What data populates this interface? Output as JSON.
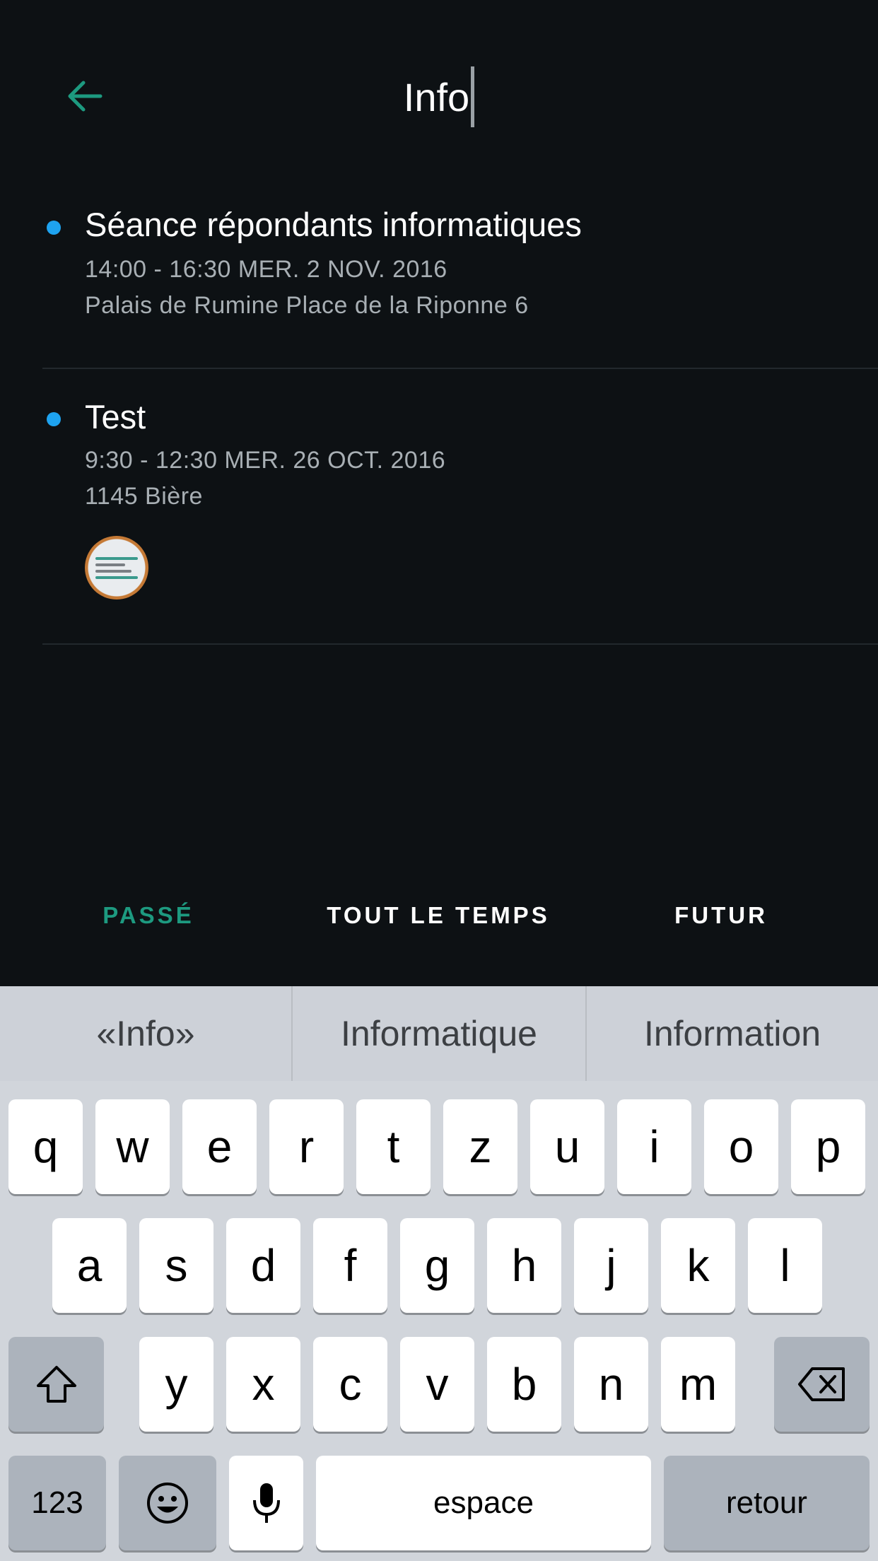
{
  "header": {
    "back_icon": "arrow-left-icon",
    "search_value": "Info",
    "accent_color": "#1d9a80"
  },
  "results": [
    {
      "title": "Séance répondants informatiques",
      "datetime": "14:00 - 16:30 MER. 2 NOV. 2016",
      "location": "Palais de Rumine Place de la Riponne 6"
    },
    {
      "title": "Test",
      "datetime": "9:30 - 12:30 MER. 26 OCT. 2016",
      "location": "1145 Bière",
      "attachment_icon": "attachment-thumbnail"
    }
  ],
  "filters": {
    "past": "PASSÉ",
    "all_time": "TOUT LE TEMPS",
    "future": "FUTUR",
    "selected": "past"
  },
  "keyboard": {
    "suggestions": [
      "«Info»",
      "Informatique",
      "Information"
    ],
    "row1": [
      "q",
      "w",
      "e",
      "r",
      "t",
      "z",
      "u",
      "i",
      "o",
      "p"
    ],
    "row2": [
      "a",
      "s",
      "d",
      "f",
      "g",
      "h",
      "j",
      "k",
      "l"
    ],
    "row3": [
      "y",
      "x",
      "c",
      "v",
      "b",
      "n",
      "m"
    ],
    "numbers_label": "123",
    "space_label": "espace",
    "return_label": "retour",
    "icons": [
      "shift-icon",
      "backspace-icon",
      "emoji-icon",
      "microphone-icon"
    ]
  }
}
